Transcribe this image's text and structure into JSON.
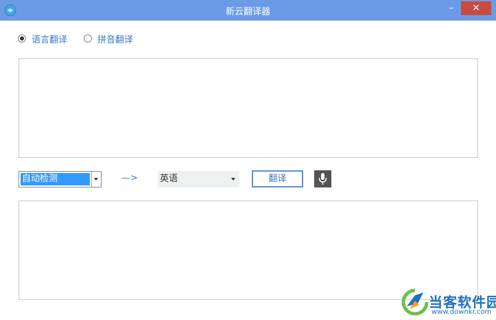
{
  "window": {
    "title": "新云翻译器",
    "minimize": "–",
    "close": "✕"
  },
  "modes": {
    "language": "语言翻译",
    "pinyin": "拼音翻译",
    "selected": "language"
  },
  "source": {
    "text": "",
    "language": "自动检测"
  },
  "direction": "—>",
  "target": {
    "language": "英语",
    "text": ""
  },
  "buttons": {
    "translate": "翻译"
  },
  "icons": {
    "app": "app-logo-icon",
    "mic": "microphone-icon",
    "dropdown": "chevron-down-icon"
  },
  "colors": {
    "titlebar": "#6b9be6",
    "close": "#c94a3e",
    "accent": "#3a78c9",
    "selection": "#3399ff"
  },
  "watermark": {
    "name": "当客软件园",
    "url": "www.downkr.com"
  }
}
